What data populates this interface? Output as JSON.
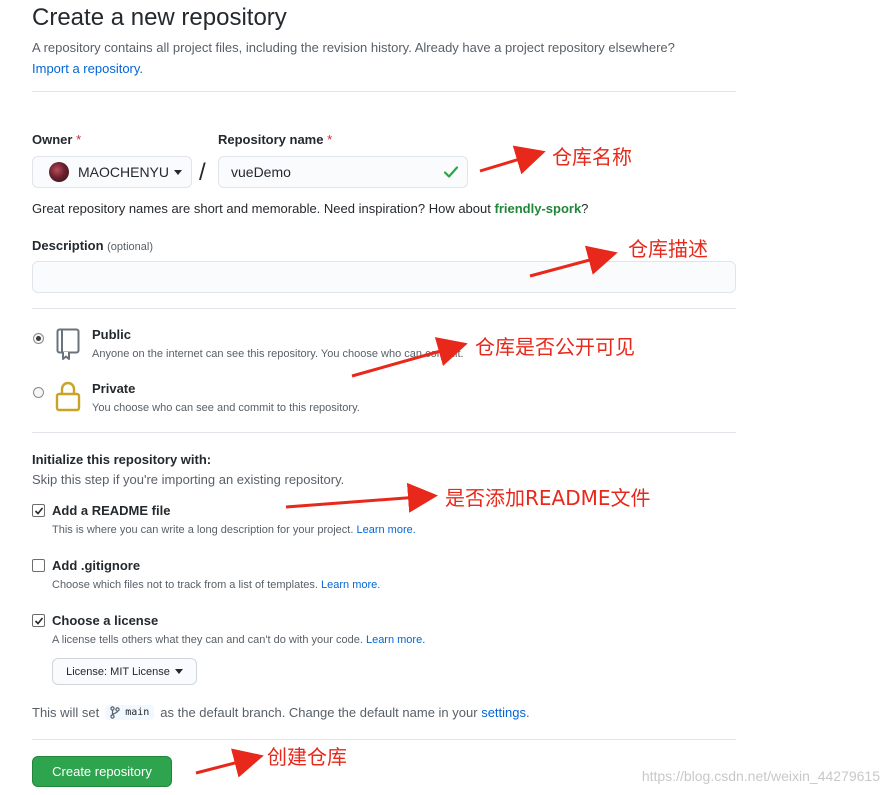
{
  "header": {
    "title": "Create a new repository",
    "subtitle": "A repository contains all project files, including the revision history. Already have a project repository elsewhere?",
    "import_link": "Import a repository."
  },
  "owner": {
    "label": "Owner",
    "required_mark": "*",
    "value": "MAOCHENYU"
  },
  "repo_name": {
    "label": "Repository name",
    "required_mark": "*",
    "value": "vueDemo",
    "hint_prefix": "Great repository names are short and memorable. Need inspiration? How about",
    "suggestion": "friendly-spork",
    "hint_suffix": "?"
  },
  "separator": "/",
  "description": {
    "label": "Description",
    "optional": "(optional)",
    "value": ""
  },
  "visibility": {
    "public": {
      "title": "Public",
      "note": "Anyone on the internet can see this repository. You choose who can commit.",
      "selected": true
    },
    "private": {
      "title": "Private",
      "note": "You choose who can see and commit to this repository.",
      "selected": false
    }
  },
  "init": {
    "title": "Initialize this repository with:",
    "subtitle": "Skip this step if you're importing an existing repository.",
    "readme": {
      "title": "Add a README file",
      "note": "This is where you can write a long description for your project.",
      "link": "Learn more.",
      "checked": true
    },
    "gitignore": {
      "title": "Add .gitignore",
      "note": "Choose which files not to track from a list of templates.",
      "link": "Learn more.",
      "checked": false
    },
    "license": {
      "title": "Choose a license",
      "note": "A license tells others what they can and can't do with your code.",
      "link": "Learn more.",
      "checked": true,
      "dropdown": "License: MIT License"
    }
  },
  "branch": {
    "prefix": "This will set",
    "name": "main",
    "middle": "as the default branch. Change the default name in your",
    "settings_link": "settings",
    "suffix": "."
  },
  "actions": {
    "create_label": "Create repository"
  },
  "annotations": {
    "repo_name": "仓库名称",
    "description": "仓库描述",
    "visibility": "仓库是否公开可见",
    "readme": "是否添加README文件",
    "create": "创建仓库"
  },
  "watermark": "https://blog.csdn.net/weixin_44279615",
  "colors": {
    "primary_button": "#2ea44f",
    "link": "#0366d6",
    "suggestion": "#22863a",
    "required": "#cb2431",
    "annotation": "#e8281a",
    "private_lock": "#c9a227"
  }
}
